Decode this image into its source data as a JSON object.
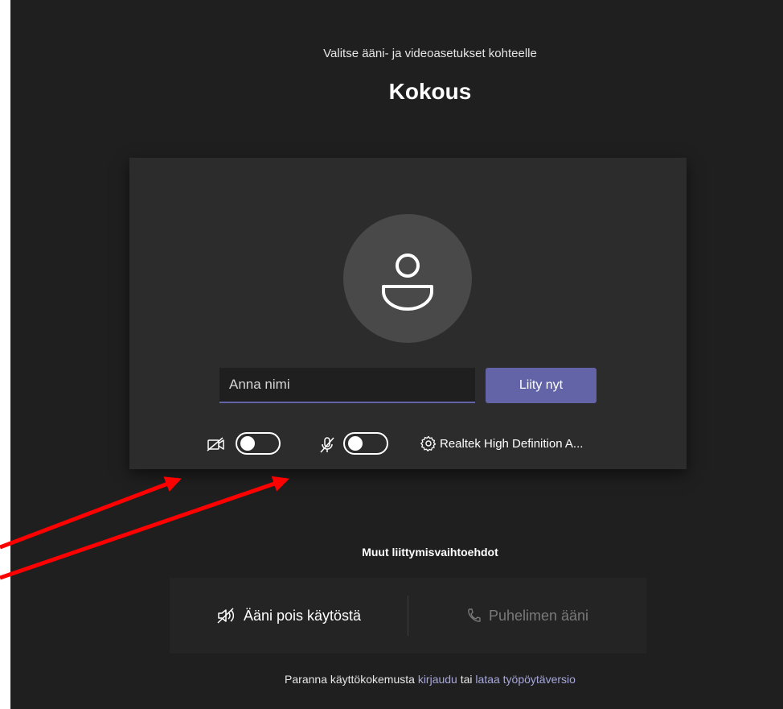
{
  "header": {
    "subtitle": "Valitse ääni- ja videoasetukset kohteelle",
    "title": "Kokous"
  },
  "prejoin": {
    "avatar_icon": "person-icon",
    "name_placeholder": "Anna nimi",
    "name_value": "",
    "join_label": "Liity nyt",
    "camera": {
      "icon": "camera-off-icon",
      "enabled": false
    },
    "microphone": {
      "icon": "mic-off-icon",
      "enabled": false
    },
    "device": {
      "icon": "gear-icon",
      "label": "Realtek High Definition A..."
    }
  },
  "other_options": {
    "heading": "Muut liittymisvaihtoehdot",
    "audio_off": {
      "icon": "speaker-off-icon",
      "label": "Ääni pois käytöstä"
    },
    "phone_audio": {
      "icon": "phone-icon",
      "label": "Puhelimen ääni"
    }
  },
  "footer": {
    "text_before": "Paranna käyttökokemusta ",
    "signin_link": "kirjaudu",
    "text_middle": " tai ",
    "download_link": "lataa työpöytäversio"
  },
  "colors": {
    "background": "#201f1f",
    "card": "#2d2c2c",
    "accent": "#6264a7",
    "link": "#a6a7dc",
    "annotation_arrow": "#ff0000"
  }
}
